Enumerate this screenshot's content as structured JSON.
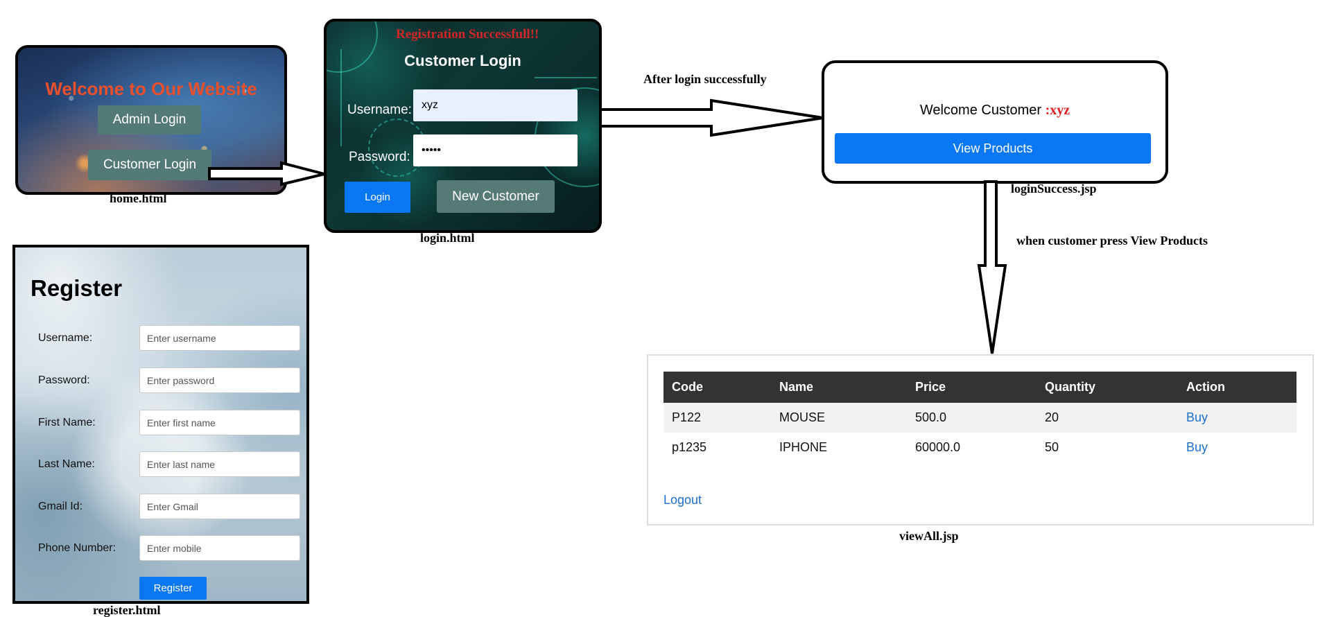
{
  "home": {
    "title": "Welcome to Our Website",
    "admin_login": "Admin Login",
    "customer_login": "Customer Login",
    "caption": "home.html"
  },
  "login": {
    "success_message": "Registration Successfull!!",
    "title": "Customer Login",
    "username_label": "Username:",
    "username_value": "xyz",
    "password_label": "Password:",
    "password_value": "•••••",
    "login_button": "Login",
    "new_customer_button": "New Customer",
    "caption": "login.html"
  },
  "register": {
    "title": "Register",
    "fields": [
      {
        "label": "Username:",
        "placeholder": "Enter username"
      },
      {
        "label": "Password:",
        "placeholder": "Enter password"
      },
      {
        "label": "First Name:",
        "placeholder": "Enter first name"
      },
      {
        "label": "Last Name:",
        "placeholder": "Enter last name"
      },
      {
        "label": "Gmail Id:",
        "placeholder": "Enter Gmail"
      },
      {
        "label": "Phone Number:",
        "placeholder": "Enter mobile"
      }
    ],
    "register_button": "Register",
    "caption": "register.html"
  },
  "login_success": {
    "welcome_text": "Welcome Customer",
    "username": ":xyz",
    "view_products_button": "View Products",
    "caption": "loginSuccess.jsp"
  },
  "view_all": {
    "headers": [
      "Code",
      "Name",
      "Price",
      "Quantity",
      "Action"
    ],
    "rows": [
      [
        "P122",
        "MOUSE",
        "500.0",
        "20",
        "Buy"
      ],
      [
        "p1235",
        "IPHONE",
        "60000.0",
        "50",
        "Buy"
      ]
    ],
    "logout": "Logout",
    "caption": "viewAll.jsp"
  },
  "flow_labels": {
    "after_login": "After login successfully",
    "view_products": "when customer press View Products"
  },
  "colors": {
    "primary_blue": "#0a78f5",
    "teal_button": "#567a76",
    "home_title": "#e8502d",
    "error_red": "#d32626",
    "table_header": "#333333",
    "link": "#1a6fd1"
  }
}
